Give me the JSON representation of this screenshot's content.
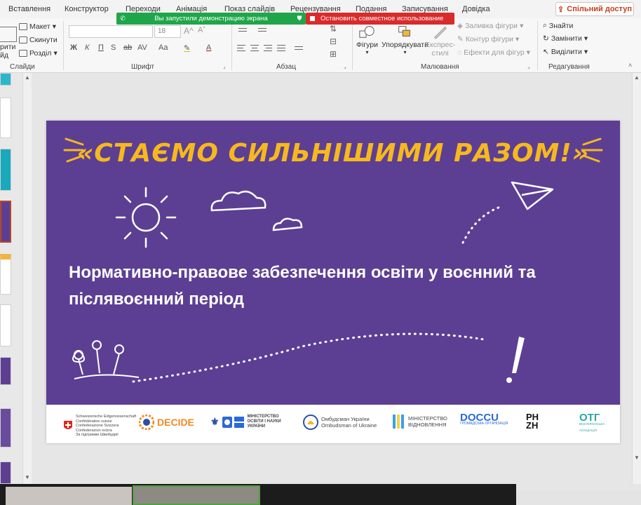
{
  "tabs": [
    "Вставлення",
    "Конструктор",
    "Переходи",
    "Анімація",
    "Показ слайдів",
    "Рецензування",
    "Подання",
    "Записування",
    "Довідка"
  ],
  "share_button": "Спільний доступ",
  "screen_share": {
    "status": "Вы запустили демонстрацию экрана",
    "stop": "Остановить совместное использование"
  },
  "ribbon": {
    "slides": {
      "layout": "Макет",
      "reset": "Скинути",
      "section": "Розділ",
      "new_slide_fragment_1": "рити",
      "new_slide_fragment_2": "йд",
      "group_label": "Слайди"
    },
    "font": {
      "size": "18",
      "group_label": "Шрифт",
      "format_glyphs": [
        "Ж",
        "К",
        "П",
        "S",
        "ab",
        "AV",
        "Aa",
        "A"
      ]
    },
    "paragraph": {
      "group_label": "Абзац"
    },
    "drawing": {
      "shapes": "Фігури",
      "arrange": "Упорядкувати",
      "quick_styles_1": "Експрес-",
      "quick_styles_2": "стилі",
      "fill": "Заливка фігури",
      "outline": "Контур фігури",
      "effects": "Ефекти для фігур",
      "group_label": "Малювання"
    },
    "editing": {
      "find": "Знайти",
      "replace": "Замінити",
      "select": "Виділити",
      "group_label": "Редагування"
    }
  },
  "slide": {
    "title": "«СТАЄМО СИЛЬНІШИМИ РАЗОМ!»",
    "subtitle_line1": "Нормативно-правове забезпечення освіти у воєнний та",
    "subtitle_line2": "післявоєнний період",
    "logos": {
      "swiss_1": "Schweizerische Eidgenossenschaft",
      "swiss_2": "Confédération suisse",
      "swiss_3": "Confederazione Svizzera",
      "swiss_4": "Confederaziun svizra",
      "swiss_5": "За підтримки Швейцарії",
      "decide": "DECIDE",
      "mon_1": "МІНІСТЕРСТВО",
      "mon_2": "ОСВІТИ І НАУКИ",
      "mon_3": "УКРАЇНИ",
      "ombudsman_1": "Омбудсман України",
      "ombudsman_2": "Ombudsman of Ukraine",
      "minvidn_1": "МІНІСТЕРСТВО",
      "minvidn_2": "ВІДНОВЛЕННЯ",
      "docc": "DOCCU",
      "docc_sub": "ГРОМАДСЬКА ОРГАНІЗАЦІЯ",
      "phzh": "PH ZH",
      "otg": "ОТГ",
      "otg_sub": "ВСЕУКРАЇНСЬКА АСОЦІАЦІЯ"
    }
  },
  "colors": {
    "slide_bg": "#5c3f93",
    "title": "#f6b81e",
    "share_text": "#c43e1c",
    "banner_green": "#1fa64a",
    "banner_red": "#d92b2b"
  }
}
